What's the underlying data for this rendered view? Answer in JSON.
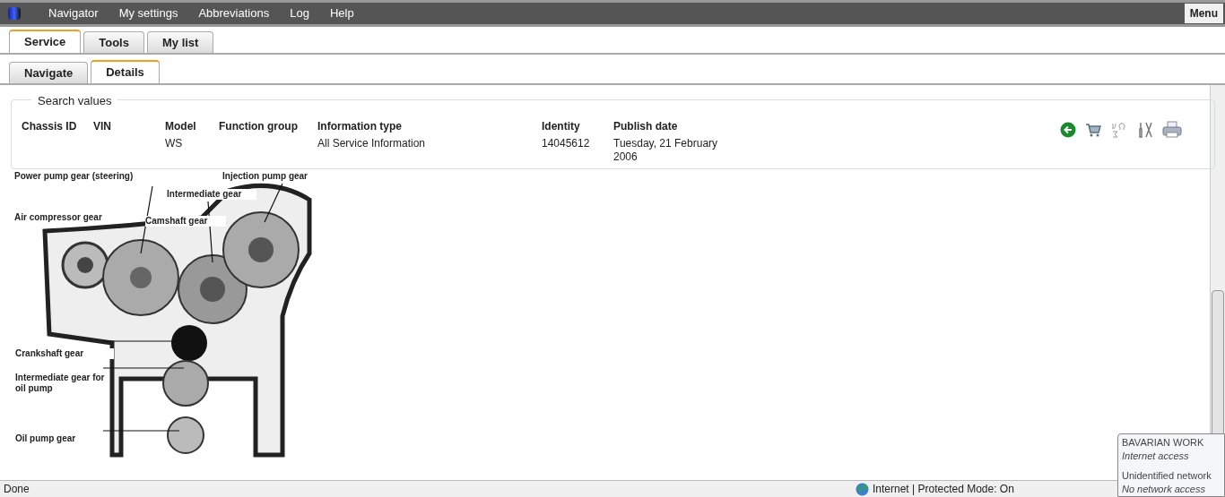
{
  "menu_bar": {
    "items": [
      "Navigator",
      "My settings",
      "Abbreviations",
      "Log",
      "Help"
    ],
    "menu_button": "Menu"
  },
  "tabs": [
    {
      "label": "Service",
      "selected": true
    },
    {
      "label": "Tools",
      "selected": false
    },
    {
      "label": "My list",
      "selected": false
    }
  ],
  "subtabs": [
    {
      "label": "Navigate",
      "selected": false
    },
    {
      "label": "Details",
      "selected": true
    }
  ],
  "search_values": {
    "title": "Search values",
    "fields": [
      {
        "label": "Chassis ID"
      },
      {
        "label": "VIN"
      },
      {
        "label": "Model",
        "value": "WS"
      },
      {
        "label": "Function group"
      },
      {
        "label": "Information type",
        "value": "All Service Information"
      },
      {
        "label": "Identity",
        "value": "14045612"
      },
      {
        "label": "Publish date",
        "value": "Tuesday, 21 February 2006"
      }
    ]
  },
  "diagram": {
    "labels": [
      "Power pump gear (steering)",
      "Injection pump gear",
      "Intermediate gear",
      "Air compressor gear",
      "Camshaft gear",
      "Crankshaft gear",
      "Intermediate gear for oil pump",
      "Oil pump gear"
    ]
  },
  "status_bar": {
    "status": "Done",
    "zone": "Internet | Protected Mode: On"
  },
  "network_tooltip": [
    {
      "name": "BAVARIAN WORK",
      "access": "Internet access"
    },
    {
      "name": "Unidentified network",
      "access": "No network access"
    }
  ]
}
